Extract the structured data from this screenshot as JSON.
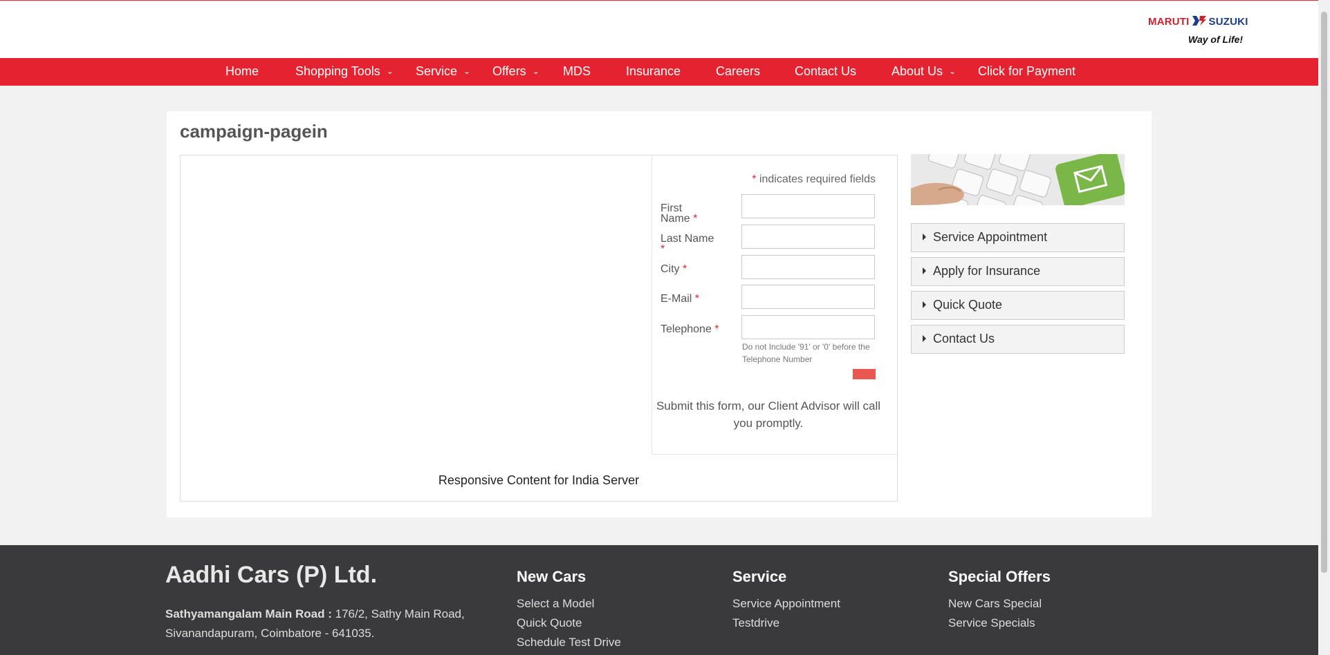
{
  "header": {
    "brand_left": "MARUTI",
    "brand_right": "SUZUKI",
    "tagline": "Way of Life!"
  },
  "nav": {
    "items": [
      {
        "label": "Home",
        "has_dropdown": false
      },
      {
        "label": "Shopping Tools",
        "has_dropdown": true
      },
      {
        "label": "Service",
        "has_dropdown": true
      },
      {
        "label": "Offers",
        "has_dropdown": true
      },
      {
        "label": "MDS",
        "has_dropdown": false
      },
      {
        "label": "Insurance",
        "has_dropdown": false
      },
      {
        "label": "Careers",
        "has_dropdown": false
      },
      {
        "label": "Contact Us",
        "has_dropdown": false
      },
      {
        "label": "About Us",
        "has_dropdown": true
      },
      {
        "label": "Click for Payment",
        "has_dropdown": false
      }
    ],
    "dropdown_glyph": "⌄"
  },
  "main": {
    "title": "campaign-pagein",
    "responsive_text": "Responsive Content for India Server"
  },
  "form": {
    "required_star": "*",
    "required_note": "indicates required fields",
    "fields": {
      "first_name_line1": "First",
      "first_name_line2": "Name",
      "last_name": "Last Name",
      "city": "City",
      "email": "E-Mail",
      "telephone": "Telephone"
    },
    "telephone_hint": "Do not Include '91' or '0' before the Telephone Number",
    "advisor_text": "Submit this form, our Client Advisor will call you promptly."
  },
  "sidebar": {
    "image_icon": "envelope-keypad-image",
    "links": [
      {
        "label": "Service Appointment"
      },
      {
        "label": "Apply for Insurance"
      },
      {
        "label": "Quick Quote"
      },
      {
        "label": "Contact Us"
      }
    ]
  },
  "footer": {
    "company": "Aadhi Cars (P) Ltd.",
    "address_bold": "Sathyamangalam Main Road :",
    "address_rest": " 176/2, Sathy Main Road, Sivanandapuram, Coimbatore - 641035.",
    "columns": [
      {
        "heading": "New Cars",
        "links": [
          "Select a Model",
          "Quick Quote",
          "Schedule Test Drive"
        ]
      },
      {
        "heading": "Service",
        "links": [
          "Service Appointment",
          "Testdrive"
        ]
      },
      {
        "heading": "Special Offers",
        "links": [
          "New Cars Special",
          "Service Specials"
        ]
      }
    ]
  },
  "colors": {
    "brand_red": "#e52330",
    "brand_blue": "#1d3b8b",
    "footer_bg": "#3a3a3c",
    "submit_button": "#e8584f",
    "accent_green": "#7ab648"
  }
}
